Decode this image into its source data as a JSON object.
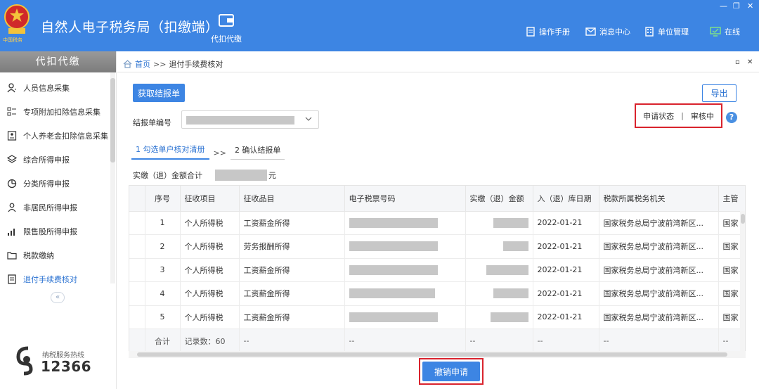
{
  "header": {
    "title": "自然人电子税务局（扣缴端）",
    "emblem_text": "中国税务",
    "module": "代扣代缴",
    "links": [
      {
        "label": "操作手册",
        "icon": "manual-icon"
      },
      {
        "label": "消息中心",
        "icon": "mail-icon"
      },
      {
        "label": "单位管理",
        "icon": "building-icon"
      },
      {
        "label": "在线",
        "icon": "monitor-icon"
      }
    ]
  },
  "sidebar": {
    "title": "代扣代缴",
    "items": [
      {
        "label": "人员信息采集",
        "icon": "person-icon"
      },
      {
        "label": "专项附加扣除信息采集",
        "icon": "list-icon"
      },
      {
        "label": "个人养老金扣除信息采集",
        "icon": "id-card-icon"
      },
      {
        "label": "综合所得申报",
        "icon": "layers-icon"
      },
      {
        "label": "分类所得申报",
        "icon": "pie-icon"
      },
      {
        "label": "非居民所得申报",
        "icon": "person-outline-icon"
      },
      {
        "label": "限售股所得申报",
        "icon": "bar-chart-icon"
      },
      {
        "label": "税款缴纳",
        "icon": "folder-icon"
      },
      {
        "label": "退付手续费核对",
        "icon": "document-icon"
      }
    ],
    "collapse": "«",
    "hotline_label": "纳税服务热线",
    "hotline_number": "12366"
  },
  "breadcrumb": {
    "home": "首页",
    "sep": ">>",
    "current": "退付手续费核对"
  },
  "toolbar": {
    "fetch_label": "获取结报单",
    "export_label": "导出"
  },
  "status": {
    "label": "申请状态",
    "divider": "|",
    "value": "审核中",
    "help": "?"
  },
  "form": {
    "report_no_label": "结报单编号"
  },
  "steps": {
    "step1": "1 勾选单户核对清册",
    "arrow": ">>",
    "step2": "2 确认结报单"
  },
  "total": {
    "label": "实缴（退）金额合计",
    "unit": "元"
  },
  "table": {
    "headers": [
      "序号",
      "征收项目",
      "征收品目",
      "电子税票号码",
      "实缴（退）金额",
      "入（退）库日期",
      "税款所属税务机关",
      "主管"
    ],
    "rows": [
      {
        "no": "1",
        "item": "个人所得税",
        "sub": "工资薪金所得",
        "date": "2022-01-21",
        "office": "国家税务总局宁波前湾新区...",
        "last": "国家"
      },
      {
        "no": "2",
        "item": "个人所得税",
        "sub": "劳务报酬所得",
        "date": "2022-01-21",
        "office": "国家税务总局宁波前湾新区...",
        "last": "国家"
      },
      {
        "no": "3",
        "item": "个人所得税",
        "sub": "工资薪金所得",
        "date": "2022-01-21",
        "office": "国家税务总局宁波前湾新区...",
        "last": "国家"
      },
      {
        "no": "4",
        "item": "个人所得税",
        "sub": "工资薪金所得",
        "date": "2022-01-21",
        "office": "国家税务总局宁波前湾新区...",
        "last": "国家"
      },
      {
        "no": "5",
        "item": "个人所得税",
        "sub": "工资薪金所得",
        "date": "2022-01-21",
        "office": "国家税务总局宁波前湾新区...",
        "last": "国家"
      }
    ],
    "summary": {
      "label": "合计",
      "count": "记录数：60",
      "dash": "--"
    }
  },
  "actions": {
    "cancel_label": "撤销申请"
  }
}
